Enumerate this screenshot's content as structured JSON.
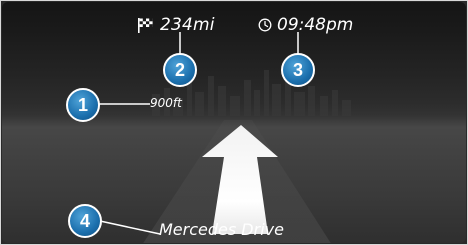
{
  "header": {
    "distance_to_destination": "234mi",
    "arrival_time": "09:48pm"
  },
  "maneuver": {
    "distance": "900ft",
    "direction_icon": "straight-arrow-icon"
  },
  "street": {
    "name": "Mercedes Drive"
  },
  "callouts": [
    {
      "label": "1"
    },
    {
      "label": "2"
    },
    {
      "label": "3"
    },
    {
      "label": "4"
    }
  ],
  "colors": {
    "callout": "#1b6fad",
    "text": "#ffffff",
    "background": "#2c2c2c"
  }
}
